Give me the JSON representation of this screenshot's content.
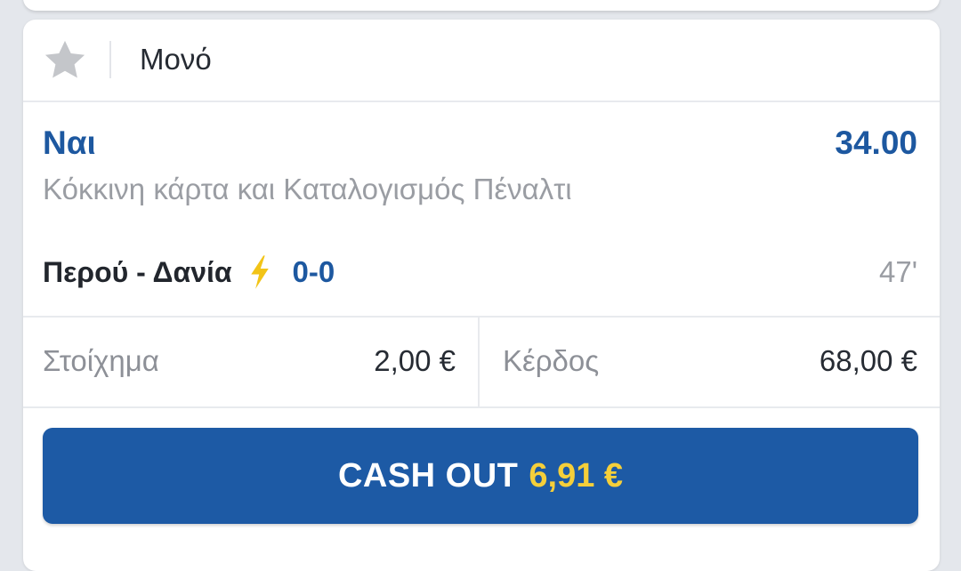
{
  "header": {
    "bet_type": "Μονό",
    "favorite_icon": "star-icon"
  },
  "selection": {
    "name": "Ναι",
    "odds": "34.00",
    "market": "Κόκκινη κάρτα και Καταλογισμός Πέναλτι"
  },
  "event": {
    "teams": "Περού - Δανία",
    "live_icon": "lightning-bolt-icon",
    "score": "0-0",
    "minute": "47'"
  },
  "amounts": {
    "stake_label": "Στοίχημα",
    "stake_value": "2,00 €",
    "win_label": "Κέρδος",
    "win_value": "68,00 €"
  },
  "cashout": {
    "label": "CASH OUT",
    "amount": "6,91 €"
  },
  "colors": {
    "primary_blue": "#1d58a0",
    "button_blue": "#1d5aa5",
    "cashout_yellow": "#f5cf3a",
    "bolt_yellow": "#f2c417",
    "star_gray": "#c4c6ca",
    "background": "#e4e7ec"
  }
}
